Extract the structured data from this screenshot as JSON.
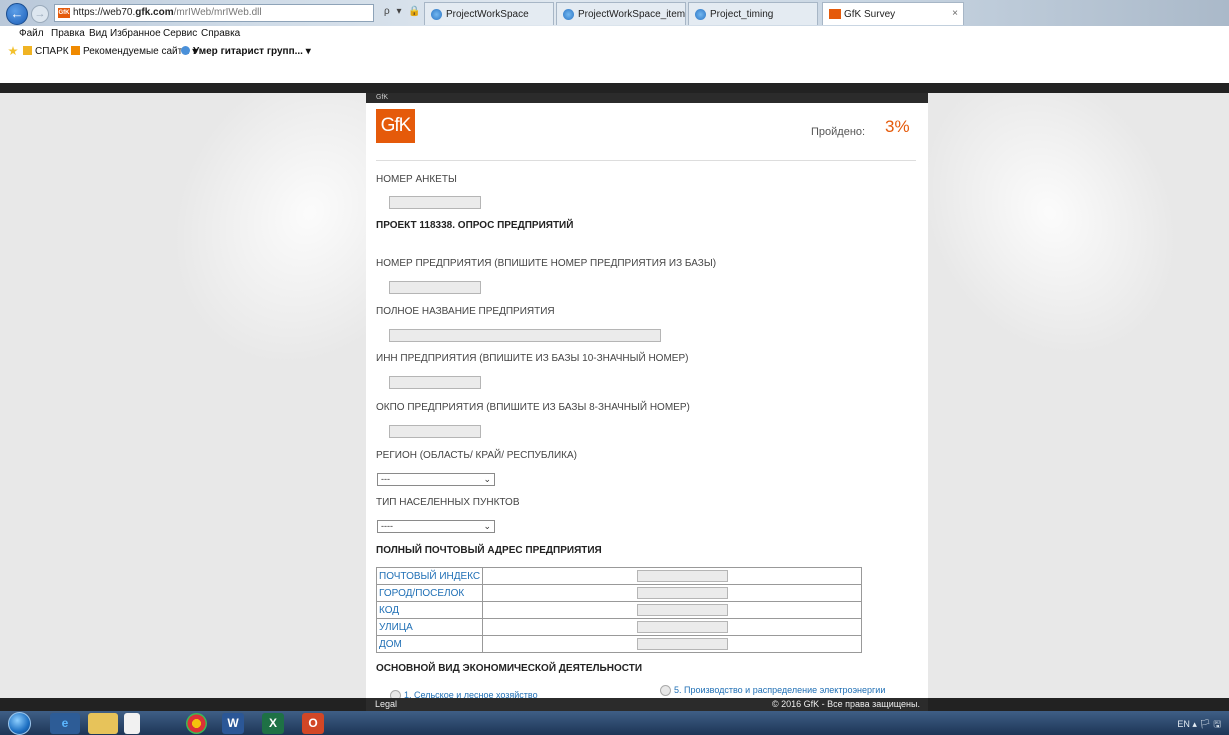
{
  "browser": {
    "address": "https://web70.gfk.com/mrIWeb/mrIWeb.dll",
    "address_host": "https://web70.",
    "address_domain": "gfk.com",
    "address_path": "/mrIWeb/mrIWeb.dll",
    "address_controls": "ρ ▾ 🔒 C",
    "tabs": [
      {
        "label": "ProjectWorkSpace",
        "active": false
      },
      {
        "label": "ProjectWorkSpace_item",
        "active": false
      },
      {
        "label": "Project_timing",
        "active": false
      },
      {
        "label": "GfK Survey",
        "active": true
      }
    ],
    "tab_close": "×",
    "menu": [
      "Файл",
      "Правка",
      "Вид",
      "Избранное",
      "Сервис",
      "Справка"
    ],
    "favorites": [
      "СПАРК",
      "Рекомендуемые сайты ▾",
      "Умер гитарист групп... ▾"
    ]
  },
  "survey": {
    "topbar_text": "GfK",
    "logo_text": "GfK",
    "progress_label": "Пройдено:",
    "progress_value": "3%",
    "progress_percent": 3,
    "questions": {
      "form_number": "НОМЕР АНКЕТЫ",
      "project_heading": "ПРОЕКТ 118338. ОПРОС ПРЕДПРИЯТИЙ",
      "company_number": "НОМЕР ПРЕДПРИЯТИЯ (ВПИШИТЕ НОМЕР ПРЕДПРИЯТИЯ ИЗ БАЗЫ)",
      "company_name": "ПОЛНОЕ НАЗВАНИЕ ПРЕДПРИЯТИЯ",
      "inn": "ИНН ПРЕДПРИЯТИЯ (ВПИШИТЕ ИЗ БАЗЫ 10-ЗНАЧНЫЙ НОМЕР)",
      "okpo": "ОКПО ПРЕДПРИЯТИЯ (ВПИШИТЕ ИЗ БАЗЫ 8-ЗНАЧНЫЙ НОМЕР)",
      "region": "РЕГИОН (ОБЛАСТЬ/ КРАЙ/ РЕСПУБЛИКА)",
      "settlement_type": "ТИП НАСЕЛЕННЫХ ПУНКТОВ",
      "address_heading": "ПОЛНЫЙ ПОЧТОВЫЙ АДРЕС ПРЕДПРИЯТИЯ",
      "activity_heading": "ОСНОВНОЙ ВИД ЭКОНОМИЧЕСКОЙ ДЕЯТЕЛЬНОСТИ"
    },
    "region_value": "---",
    "settlement_value": "----",
    "dropdown_arrow": "⌄",
    "address_rows": [
      "ПОЧТОВЫЙ ИНДЕКС",
      "ГОРОД/ПОСЕЛОК",
      "КОД",
      "УЛИЦА",
      "ДОМ"
    ],
    "activity_options": [
      "1. Сельское и лесное хозяйство",
      "5. Производство и распределение электроэнергии"
    ]
  },
  "footer": {
    "legal": "Legal",
    "copyright": "© 2016 GfK - Все права защищены."
  },
  "taskbar": {
    "tray": "EN  ▴  🏳  🖫"
  },
  "colors": {
    "accent": "#e55a0a",
    "link": "#1f6fb5",
    "footer_bg": "#2b2b2b"
  }
}
